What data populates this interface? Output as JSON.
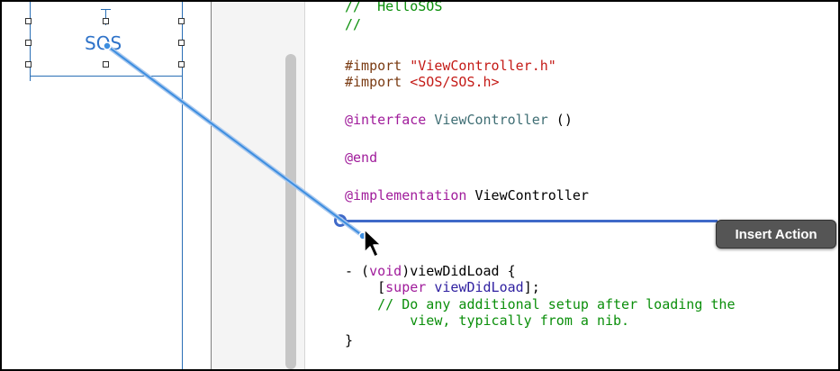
{
  "storyboard": {
    "button_label": "SOS"
  },
  "editor": {
    "lines": {
      "l0": "//  HelloSOS",
      "l1": "//",
      "import1_kw": "#import",
      "import1_str": "\"ViewController.h\"",
      "import2_kw": "#import",
      "import2_str": "<SOS/SOS.h>",
      "interface_kw": "@interface",
      "interface_name": "ViewController",
      "interface_rest": " ()",
      "end_kw": "@end",
      "impl_kw": "@implementation",
      "impl_name": "ViewController",
      "method_a": "- (",
      "method_void": "void",
      "method_b": ")viewDidLoad {",
      "super_a": "[",
      "super_kw": "super",
      "super_call": "viewDidLoad",
      "super_b": "];",
      "comment1": "// Do any additional setup after loading the",
      "comment2": "view, typically from a nib.",
      "close_brace": "}"
    }
  },
  "tooltip": {
    "label": "Insert Action"
  },
  "colors": {
    "connection_line": "#3f69c8",
    "sos_text": "#2f73c9",
    "tooltip_bg": "#555555"
  }
}
